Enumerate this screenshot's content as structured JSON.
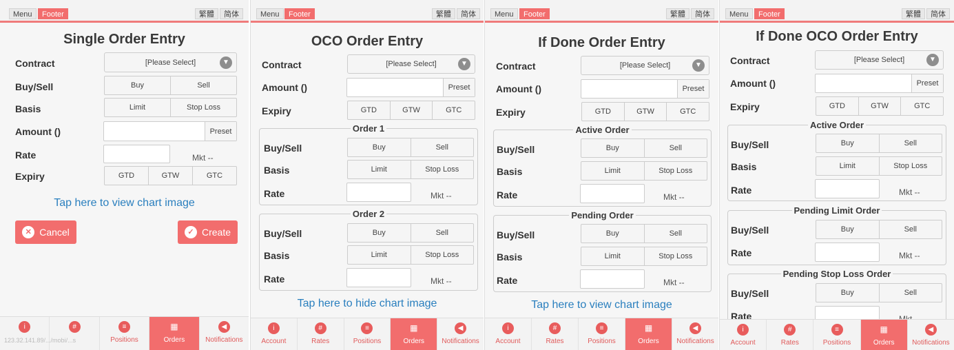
{
  "header": {
    "menu_label": "Menu",
    "footer_label": "Footer",
    "trad_chinese_label": "繁體",
    "simp_chinese_label": "简体"
  },
  "field_labels": {
    "contract": "Contract",
    "buy_sell": "Buy/Sell",
    "basis": "Basis",
    "amount": "Amount ()",
    "rate": "Rate",
    "expiry": "Expiry"
  },
  "options": {
    "please_select": "[Please Select]",
    "buy": "Buy",
    "sell": "Sell",
    "limit": "Limit",
    "stop_loss": "Stop Loss",
    "gtd": "GTD",
    "gtw": "GTW",
    "gtc": "GTC",
    "preset": "Preset",
    "mkt": "Mkt --"
  },
  "panels": [
    {
      "title": "Single Order Entry",
      "chart_link": "Tap here to view chart image",
      "cancel_label": "Cancel",
      "create_label": "Create"
    },
    {
      "title": "OCO Order Entry",
      "group1": "Order 1",
      "group2": "Order 2",
      "chart_link": "Tap here to hide chart image"
    },
    {
      "title": "If Done Order Entry",
      "group1": "Active Order",
      "group2": "Pending Order",
      "chart_link": "Tap here to view chart image"
    },
    {
      "title": "If Done OCO Order Entry",
      "group1": "Active Order",
      "group2": "Pending Limit Order",
      "group3": "Pending Stop Loss Order"
    }
  ],
  "tabs": [
    {
      "label": "Account",
      "icon": "info-icon"
    },
    {
      "label": "Rates",
      "icon": "grid-icon"
    },
    {
      "label": "Positions",
      "icon": "list-icon"
    },
    {
      "label": "Orders",
      "icon": "calendar-icon"
    },
    {
      "label": "Notifications",
      "icon": "speaker-icon"
    }
  ],
  "status_url": "123.32.141.89/.../mobi/...s",
  "colors": {
    "accent": "#f26d6d",
    "link": "#2a7fbe"
  }
}
